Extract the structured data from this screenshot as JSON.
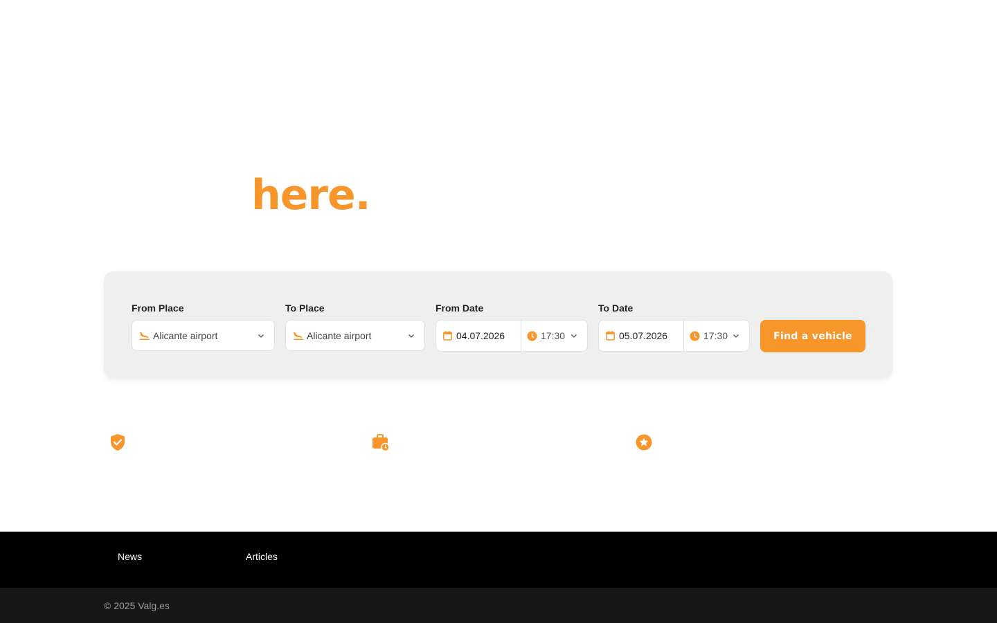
{
  "hero": {
    "title": "here."
  },
  "search": {
    "from_place": {
      "label": "From Place",
      "value": "Alicante airport",
      "icon": "plane-landing-icon"
    },
    "to_place": {
      "label": "To Place",
      "value": "Alicante airport",
      "icon": "plane-landing-icon"
    },
    "from_date": {
      "label": "From Date",
      "date": "04.07.2026",
      "time": "17:30"
    },
    "to_date": {
      "label": "To Date",
      "date": "05.07.2026",
      "time": "17:30"
    },
    "submit_label": "Find a vehicle"
  },
  "features": [
    {
      "icon": "shield-check-icon"
    },
    {
      "icon": "briefcase-clock-icon"
    },
    {
      "icon": "star-badge-icon"
    }
  ],
  "footer": {
    "links": [
      "News",
      "Articles"
    ],
    "copyright": "© 2025 Valg.es"
  },
  "colors": {
    "accent": "#f7962b",
    "panel": "#efefef",
    "footer": "#000000",
    "bottom_bar": "#161616"
  }
}
